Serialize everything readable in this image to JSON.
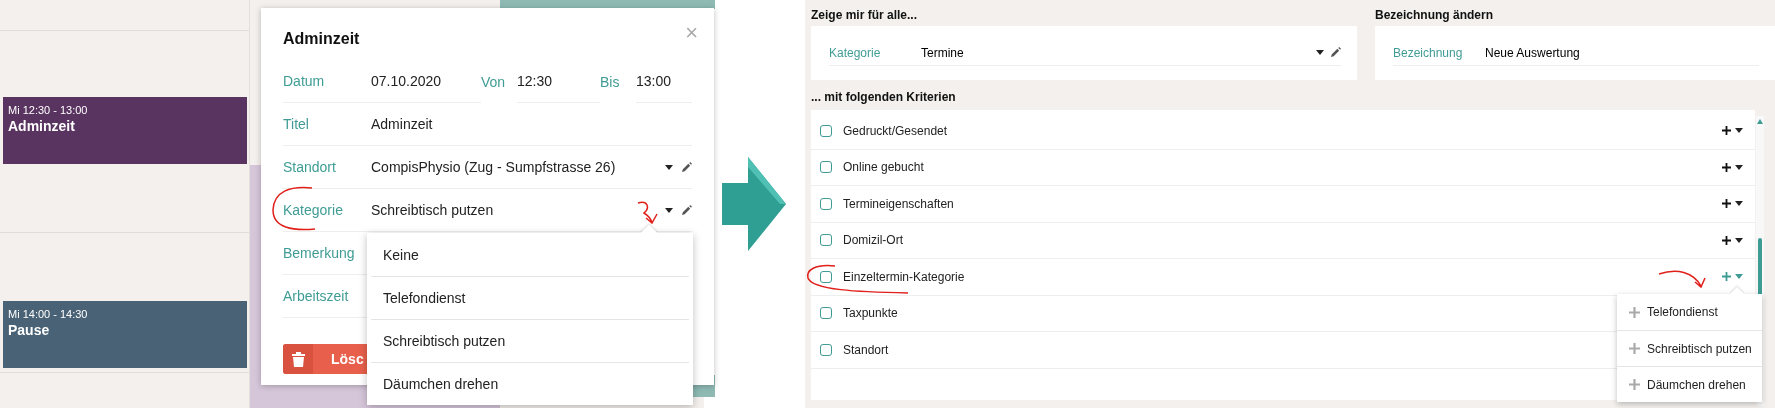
{
  "calendar": {
    "events": [
      {
        "time": "Mi 12:30 - 13:00",
        "title": "Adminzeit",
        "color": "#5a3461"
      },
      {
        "time": "Mi 14:00 - 14:30",
        "title": "Pause",
        "color": "#4a6275"
      }
    ]
  },
  "appointment_popup": {
    "title": "Adminzeit",
    "close": "×",
    "date": {
      "label": "Datum",
      "value": "07.10.2020"
    },
    "from": {
      "label": "Von",
      "value": "12:30"
    },
    "to": {
      "label": "Bis",
      "value": "13:00"
    },
    "fields": [
      {
        "kind": "text",
        "label": "Titel",
        "value": "Adminzeit"
      },
      {
        "kind": "select",
        "label": "Standort",
        "value": "CompisPhysio (Zug - Sumpfstrasse 26)"
      },
      {
        "kind": "select",
        "label": "Kategorie",
        "value": "Schreibtisch putzen"
      },
      {
        "kind": "text",
        "label": "Bemerkung"
      },
      {
        "kind": "text",
        "label": "Arbeitszeit"
      }
    ],
    "delete_button": "Lösc",
    "category_menu": [
      "Keine",
      "Telefondienst",
      "Schreibtisch putzen",
      "Däumchen drehen"
    ]
  },
  "report": {
    "filter": {
      "heading": "Zeige mir für alle...",
      "label": "Kategorie",
      "value": "Termine"
    },
    "name": {
      "heading": "Bezeichnung ändern",
      "label": "Bezeichnung",
      "value": "Neue Auswertung"
    },
    "criteria": {
      "heading": "... mit folgenden Kriterien",
      "items": [
        {
          "label": "Gedruckt/Gesendet",
          "checked": false,
          "open": false
        },
        {
          "label": "Online gebucht",
          "checked": false,
          "open": false
        },
        {
          "label": "Termineigenschaften",
          "checked": false,
          "open": false
        },
        {
          "label": "Domizil-Ort",
          "checked": false,
          "open": false
        },
        {
          "label": "Einzeltermin-Kategorie",
          "checked": false,
          "open": true
        },
        {
          "label": "Taxpunkte",
          "checked": false
        },
        {
          "label": "Standort",
          "checked": false
        }
      ]
    },
    "add_menu": [
      "Telefondienst",
      "Schreibtisch putzen",
      "Däumchen drehen"
    ]
  }
}
